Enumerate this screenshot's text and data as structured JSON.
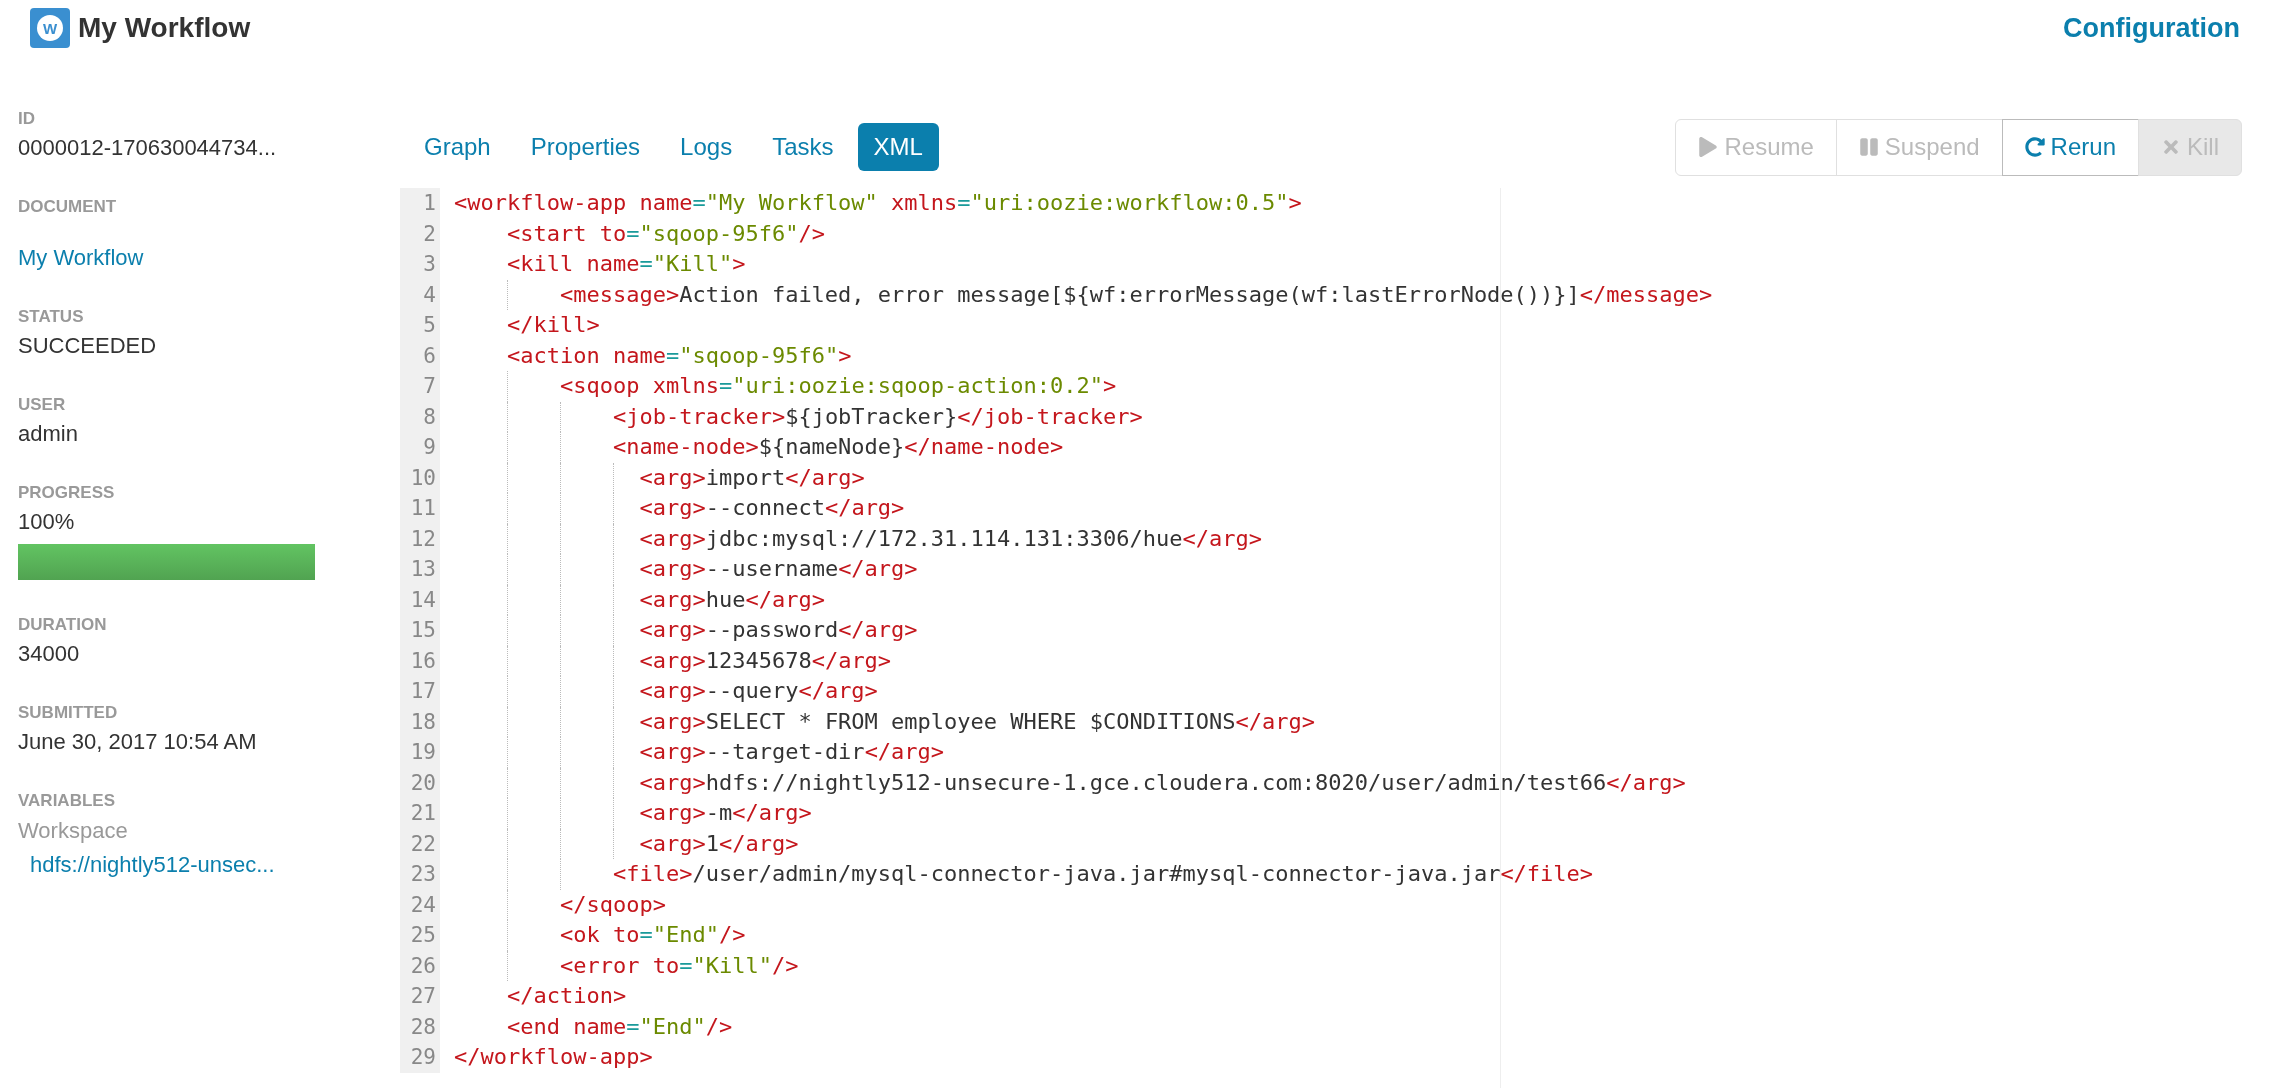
{
  "header": {
    "title": "My Workflow",
    "logo_letter": "W",
    "configuration": "Configuration"
  },
  "sidebar": [
    {
      "kind": "text",
      "label": "ID",
      "value": "0000012-170630044734..."
    },
    {
      "kind": "link",
      "label": "DOCUMENT",
      "value": "My Workflow"
    },
    {
      "kind": "text",
      "label": "STATUS",
      "value": "SUCCEEDED"
    },
    {
      "kind": "text",
      "label": "USER",
      "value": "admin"
    },
    {
      "kind": "progress",
      "label": "PROGRESS",
      "value": "100%",
      "level": 1
    },
    {
      "kind": "text",
      "label": "DURATION",
      "value": "34000"
    },
    {
      "kind": "text",
      "label": "SUBMITTED",
      "value": "June 30, 2017 10:54 AM"
    },
    {
      "kind": "variables",
      "label": "VARIABLES",
      "name": "Workspace",
      "value": "hdfs://nightly512-unsec..."
    }
  ],
  "tabs": [
    {
      "label": "Graph",
      "selected": false
    },
    {
      "label": "Properties",
      "selected": false
    },
    {
      "label": "Logs",
      "selected": false
    },
    {
      "label": "Tasks",
      "selected": false
    },
    {
      "label": "XML",
      "selected": true
    }
  ],
  "actions": [
    {
      "label": "Resume",
      "kind": "default",
      "disabled": true
    },
    {
      "label": "Suspend",
      "kind": "default",
      "disabled": true
    },
    {
      "label": "Rerun",
      "kind": "default",
      "disabled": false
    },
    {
      "label": "Kill",
      "kind": "danger",
      "disabled": true
    }
  ],
  "code": [
    {
      "number": "1",
      "tokens": [
        {
          "kind": "tag",
          "text": "<workflow-app"
        },
        {
          "kind": "attr",
          "text": " name"
        },
        {
          "kind": "eq",
          "text": "="
        },
        {
          "kind": "value",
          "text": "\"My Workflow\""
        },
        {
          "kind": "attr",
          "text": " xmlns"
        },
        {
          "kind": "eq",
          "text": "="
        },
        {
          "kind": "value",
          "text": "\"uri:oozie:workflow:0.5\""
        },
        {
          "kind": "tag",
          "text": ">"
        }
      ]
    },
    {
      "number": "2",
      "tokens": [
        {
          "kind": "tag",
          "text": "    <start"
        },
        {
          "kind": "attr",
          "text": " to"
        },
        {
          "kind": "eq",
          "text": "="
        },
        {
          "kind": "value",
          "text": "\"sqoop-95f6\""
        },
        {
          "kind": "tag",
          "text": "/>"
        }
      ]
    },
    {
      "number": "3",
      "tokens": [
        {
          "kind": "tag",
          "text": "    <kill"
        },
        {
          "kind": "attr",
          "text": " name"
        },
        {
          "kind": "eq",
          "text": "="
        },
        {
          "kind": "value",
          "text": "\"Kill\""
        },
        {
          "kind": "tag",
          "text": ">"
        }
      ]
    },
    {
      "number": "4",
      "tokens": [
        {
          "kind": "tag",
          "text": "        <message>"
        },
        {
          "kind": "text",
          "text": "Action failed, error message[${wf:errorMessage(wf:lastErrorNode())}]"
        },
        {
          "kind": "tag",
          "text": "</message>"
        }
      ]
    },
    {
      "number": "5",
      "tokens": [
        {
          "kind": "tag",
          "text": "    </kill>"
        }
      ]
    },
    {
      "number": "6",
      "tokens": [
        {
          "kind": "tag",
          "text": "    <action"
        },
        {
          "kind": "attr",
          "text": " name"
        },
        {
          "kind": "eq",
          "text": "="
        },
        {
          "kind": "value",
          "text": "\"sqoop-95f6\""
        },
        {
          "kind": "tag",
          "text": ">"
        }
      ]
    },
    {
      "number": "7",
      "tokens": [
        {
          "kind": "tag",
          "text": "        <sqoop"
        },
        {
          "kind": "attr",
          "text": " xmlns"
        },
        {
          "kind": "eq",
          "text": "="
        },
        {
          "kind": "value",
          "text": "\"uri:oozie:sqoop-action:0.2\""
        },
        {
          "kind": "tag",
          "text": ">"
        }
      ]
    },
    {
      "number": "8",
      "tokens": [
        {
          "kind": "tag",
          "text": "            <job-tracker>"
        },
        {
          "kind": "text",
          "text": "${jobTracker}"
        },
        {
          "kind": "tag",
          "text": "</job-tracker>"
        }
      ]
    },
    {
      "number": "9",
      "tokens": [
        {
          "kind": "tag",
          "text": "            <name-node>"
        },
        {
          "kind": "text",
          "text": "${nameNode}"
        },
        {
          "kind": "tag",
          "text": "</name-node>"
        }
      ]
    },
    {
      "number": "10",
      "tokens": [
        {
          "kind": "tag",
          "text": "              <arg>"
        },
        {
          "kind": "text",
          "text": "import"
        },
        {
          "kind": "tag",
          "text": "</arg>"
        }
      ]
    },
    {
      "number": "11",
      "tokens": [
        {
          "kind": "tag",
          "text": "              <arg>"
        },
        {
          "kind": "text",
          "text": "--connect"
        },
        {
          "kind": "tag",
          "text": "</arg>"
        }
      ]
    },
    {
      "number": "12",
      "tokens": [
        {
          "kind": "tag",
          "text": "              <arg>"
        },
        {
          "kind": "text",
          "text": "jdbc:mysql://172.31.114.131:3306/hue"
        },
        {
          "kind": "tag",
          "text": "</arg>"
        }
      ]
    },
    {
      "number": "13",
      "tokens": [
        {
          "kind": "tag",
          "text": "              <arg>"
        },
        {
          "kind": "text",
          "text": "--username"
        },
        {
          "kind": "tag",
          "text": "</arg>"
        }
      ]
    },
    {
      "number": "14",
      "tokens": [
        {
          "kind": "tag",
          "text": "              <arg>"
        },
        {
          "kind": "text",
          "text": "hue"
        },
        {
          "kind": "tag",
          "text": "</arg>"
        }
      ]
    },
    {
      "number": "15",
      "tokens": [
        {
          "kind": "tag",
          "text": "              <arg>"
        },
        {
          "kind": "text",
          "text": "--password"
        },
        {
          "kind": "tag",
          "text": "</arg>"
        }
      ]
    },
    {
      "number": "16",
      "tokens": [
        {
          "kind": "tag",
          "text": "              <arg>"
        },
        {
          "kind": "text",
          "text": "12345678"
        },
        {
          "kind": "tag",
          "text": "</arg>"
        }
      ]
    },
    {
      "number": "17",
      "tokens": [
        {
          "kind": "tag",
          "text": "              <arg>"
        },
        {
          "kind": "text",
          "text": "--query"
        },
        {
          "kind": "tag",
          "text": "</arg>"
        }
      ]
    },
    {
      "number": "18",
      "tokens": [
        {
          "kind": "tag",
          "text": "              <arg>"
        },
        {
          "kind": "text",
          "text": "SELECT * FROM employee WHERE $CONDITIONS"
        },
        {
          "kind": "tag",
          "text": "</arg>"
        }
      ]
    },
    {
      "number": "19",
      "tokens": [
        {
          "kind": "tag",
          "text": "              <arg>"
        },
        {
          "kind": "text",
          "text": "--target-dir"
        },
        {
          "kind": "tag",
          "text": "</arg>"
        }
      ]
    },
    {
      "number": "20",
      "tokens": [
        {
          "kind": "tag",
          "text": "              <arg>"
        },
        {
          "kind": "text",
          "text": "hdfs://nightly512-unsecure-1.gce.cloudera.com:8020/user/admin/test66"
        },
        {
          "kind": "tag",
          "text": "</arg>"
        }
      ]
    },
    {
      "number": "21",
      "tokens": [
        {
          "kind": "tag",
          "text": "              <arg>"
        },
        {
          "kind": "text",
          "text": "-m"
        },
        {
          "kind": "tag",
          "text": "</arg>"
        }
      ]
    },
    {
      "number": "22",
      "tokens": [
        {
          "kind": "tag",
          "text": "              <arg>"
        },
        {
          "kind": "text",
          "text": "1"
        },
        {
          "kind": "tag",
          "text": "</arg>"
        }
      ]
    },
    {
      "number": "23",
      "tokens": [
        {
          "kind": "tag",
          "text": "            <file>"
        },
        {
          "kind": "text",
          "text": "/user/admin/mysql-connector-java.jar#mysql-connector-java.jar"
        },
        {
          "kind": "tag",
          "text": "</file>"
        }
      ]
    },
    {
      "number": "24",
      "tokens": [
        {
          "kind": "tag",
          "text": "        </sqoop>"
        }
      ]
    },
    {
      "number": "25",
      "tokens": [
        {
          "kind": "tag",
          "text": "        <ok"
        },
        {
          "kind": "attr",
          "text": " to"
        },
        {
          "kind": "eq",
          "text": "="
        },
        {
          "kind": "value",
          "text": "\"End\""
        },
        {
          "kind": "tag",
          "text": "/>"
        }
      ]
    },
    {
      "number": "26",
      "tokens": [
        {
          "kind": "tag",
          "text": "        <error"
        },
        {
          "kind": "attr",
          "text": " to"
        },
        {
          "kind": "eq",
          "text": "="
        },
        {
          "kind": "value",
          "text": "\"Kill\""
        },
        {
          "kind": "tag",
          "text": "/>"
        }
      ]
    },
    {
      "number": "27",
      "tokens": [
        {
          "kind": "tag",
          "text": "    </action>"
        }
      ]
    },
    {
      "number": "28",
      "tokens": [
        {
          "kind": "tag",
          "text": "    <end"
        },
        {
          "kind": "attr",
          "text": " name"
        },
        {
          "kind": "eq",
          "text": "="
        },
        {
          "kind": "value",
          "text": "\"End\""
        },
        {
          "kind": "tag",
          "text": "/>"
        }
      ]
    },
    {
      "number": "29",
      "tokens": [
        {
          "kind": "tag",
          "text": "</workflow-app>"
        }
      ]
    }
  ]
}
